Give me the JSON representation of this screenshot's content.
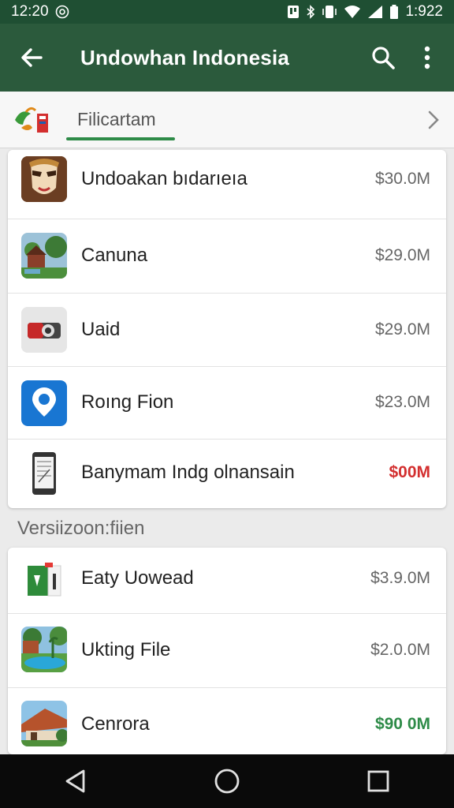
{
  "status_bar": {
    "time_left": "12:20",
    "time_right": "1:922",
    "icons": [
      "at-icon",
      "notification-icon",
      "bluetooth-icon",
      "vibrate-icon",
      "wifi-icon",
      "signal-icon",
      "battery-icon"
    ]
  },
  "app_bar": {
    "title": "Undowhan Indonesia",
    "back_icon": "arrow-left-icon",
    "actions": [
      "search-icon",
      "more-vert-icon"
    ]
  },
  "filter": {
    "label": "Filicartam",
    "accent": "#2e8b48"
  },
  "list_primary": [
    {
      "name": "Undoakan bıdarıeıa",
      "size": "$30.0M",
      "size_color": "#666666",
      "icon": "mask-app-icon"
    },
    {
      "name": "Canuna",
      "size": "$29.0M",
      "size_color": "#666666",
      "icon": "house-photo-icon"
    },
    {
      "name": "Uaid",
      "size": "$29.0M",
      "size_color": "#666666",
      "icon": "camera-app-icon"
    },
    {
      "name": "Roıng Fion",
      "size": "$23.0M",
      "size_color": "#666666",
      "icon": "location-app-icon"
    },
    {
      "name": "Banymam Indg olnansain",
      "size": "$00M",
      "size_color": "#d32f2f",
      "icon": "phone-doc-icon"
    }
  ],
  "section_title": "Versiizoon:fiien",
  "list_secondary": [
    {
      "name": "Eaty Uowead",
      "size": "$3.9.0M",
      "size_color": "#666666",
      "icon": "file-app-icon"
    },
    {
      "name": "Ukting File",
      "size": "$2.0.0M",
      "size_color": "#666666",
      "icon": "pool-photo-icon"
    },
    {
      "name": "Cenrora",
      "size": "$90 0M",
      "size_color": "#2e8b48",
      "icon": "roof-photo-icon"
    }
  ],
  "nav": [
    "back-triangle-icon",
    "home-circle-icon",
    "recents-square-icon"
  ],
  "colors": {
    "app_bar": "#2b5a3c",
    "status_bar": "#1f4f33",
    "background": "#ebebeb"
  }
}
